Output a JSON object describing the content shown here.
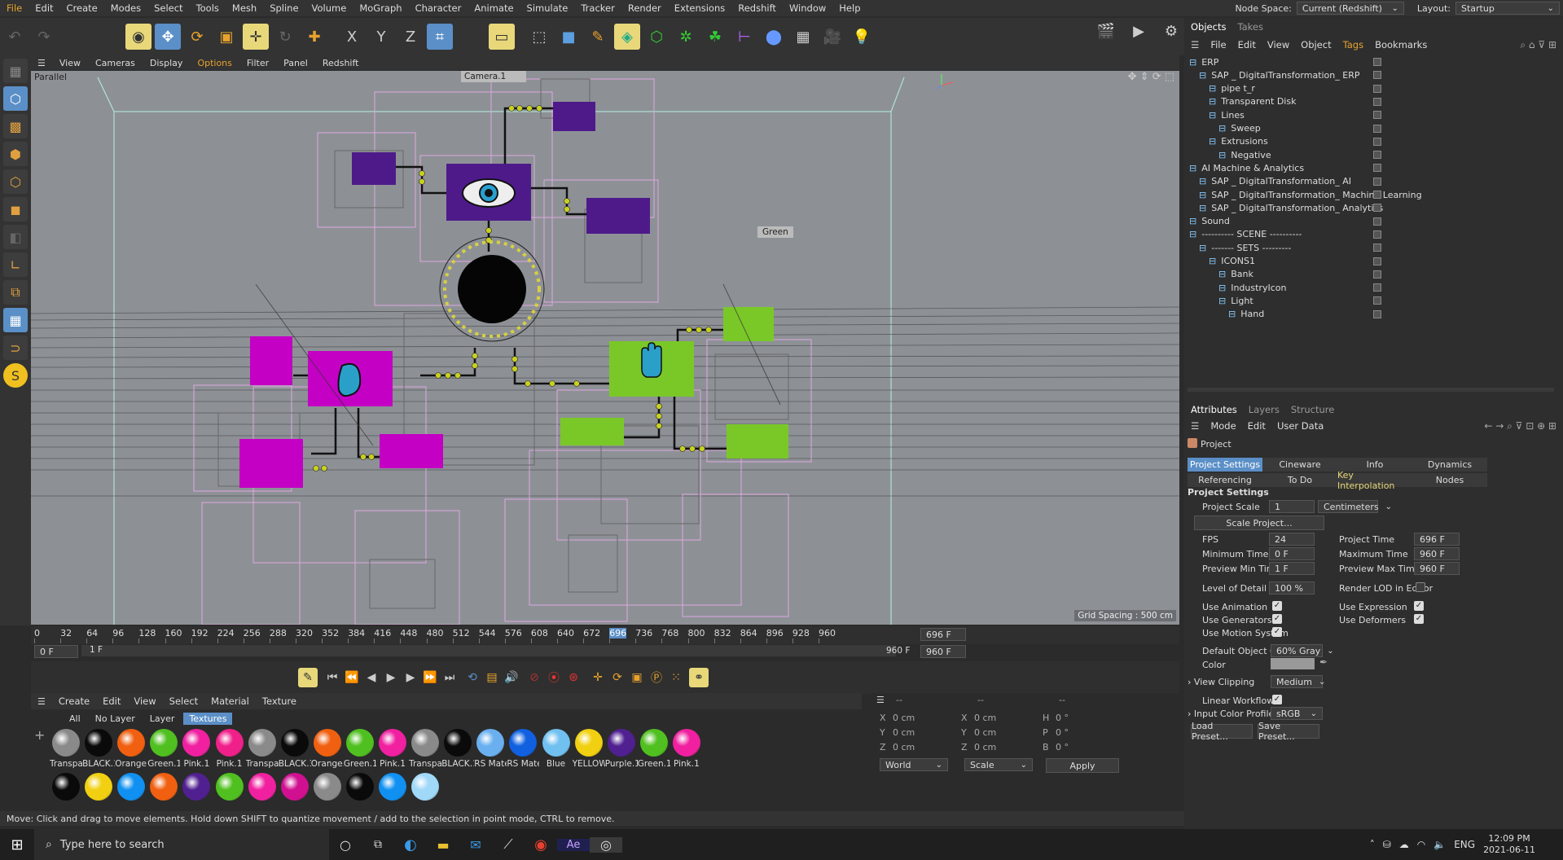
{
  "menubar": {
    "items": [
      "File",
      "Edit",
      "Create",
      "Modes",
      "Select",
      "Tools",
      "Mesh",
      "Spline",
      "Volume",
      "MoGraph",
      "Character",
      "Animate",
      "Simulate",
      "Tracker",
      "Render",
      "Extensions",
      "Redshift",
      "Window",
      "Help"
    ],
    "node_space_label": "Node Space:",
    "node_space_value": "Current (Redshift)",
    "layout_label": "Layout:",
    "layout_value": "Startup"
  },
  "viewport": {
    "menu": [
      "View",
      "Cameras",
      "Display",
      "Options",
      "Filter",
      "Panel",
      "Redshift"
    ],
    "active_menu": "Options",
    "projection": "Parallel",
    "camera": "Camera.1",
    "tag_label": "Green",
    "grid_spacing": "Grid Spacing : 500 cm",
    "colors": {
      "bg": "#8d9196",
      "purple": "#4e1a8a",
      "magenta": "#c400c4",
      "green": "#7ac828"
    }
  },
  "timeline": {
    "ticks": [
      "0",
      "32",
      "64",
      "96",
      "128",
      "160",
      "192",
      "224",
      "256",
      "288",
      "320",
      "352",
      "384",
      "416",
      "448",
      "480",
      "512",
      "544",
      "576",
      "608",
      "640",
      "672",
      "696",
      "736",
      "768",
      "800",
      "832",
      "864",
      "896",
      "928",
      "960"
    ],
    "current_frame": "696 F",
    "end_frame": "960 F",
    "range_start": "0 F",
    "range_label": "1 F",
    "range_end": "960 F",
    "range_end2": "960 F"
  },
  "materials": {
    "menu": [
      "Create",
      "Edit",
      "View",
      "Select",
      "Material",
      "Texture"
    ],
    "filters": [
      "All",
      "No Layer",
      "Layer",
      "Textures"
    ],
    "active_filter": "Textures",
    "row1": [
      {
        "name": "Transpar",
        "color": "#8a8a8a"
      },
      {
        "name": "BLACK.1",
        "color": "#0a0a0a"
      },
      {
        "name": "Orange.",
        "color": "#f06010"
      },
      {
        "name": "Green.1",
        "color": "#50c020"
      },
      {
        "name": "Pink.1",
        "color": "#f020a0"
      },
      {
        "name": "Pink.1",
        "color": "#f0208a"
      },
      {
        "name": "Transpar",
        "color": "#8a8a8a"
      },
      {
        "name": "BLACK.1",
        "color": "#0a0a0a"
      },
      {
        "name": "Orange.",
        "color": "#f06010"
      },
      {
        "name": "Green.1",
        "color": "#50c020"
      },
      {
        "name": "Pink.1",
        "color": "#f020a0"
      },
      {
        "name": "Transpar",
        "color": "#8a8a8a"
      },
      {
        "name": "BLACK.1",
        "color": "#0a0a0a"
      },
      {
        "name": "RS Mate",
        "color": "#6ab0f0"
      },
      {
        "name": "RS Mate",
        "color": "#1060e0"
      },
      {
        "name": "Blue",
        "color": "#70c0f0"
      },
      {
        "name": "YELLOW",
        "color": "#f0d010"
      },
      {
        "name": "Purple.1",
        "color": "#502090"
      },
      {
        "name": "Green.1",
        "color": "#50c020"
      },
      {
        "name": "Pink.1",
        "color": "#f020a0"
      }
    ],
    "row2_colors": [
      "#0a0a0a",
      "#f0d010",
      "#1090f0",
      "#f06010",
      "#502090",
      "#50c020",
      "#f020a0",
      "#d01090",
      "#8a8a8a",
      "#0a0a0a",
      "#1090f0",
      "#a0d8f8"
    ]
  },
  "coords": {
    "headers": [
      "--",
      "--",
      "--"
    ],
    "rows": [
      {
        "a": "X",
        "av": "0 cm",
        "b": "X",
        "bv": "0 cm",
        "c": "H",
        "cv": "0 °"
      },
      {
        "a": "Y",
        "av": "0 cm",
        "b": "Y",
        "bv": "0 cm",
        "c": "P",
        "cv": "0 °"
      },
      {
        "a": "Z",
        "av": "0 cm",
        "b": "Z",
        "bv": "0 cm",
        "c": "B",
        "cv": "0 °"
      }
    ],
    "mode1": "World",
    "mode2": "Scale",
    "apply": "Apply"
  },
  "statusbar": {
    "text": "Move: Click and drag to move elements. Hold down SHIFT to quantize movement / add to the selection in point mode, CTRL to remove."
  },
  "taskbar": {
    "search_placeholder": "Type here to search",
    "lang": "ENG",
    "time": "12:09 PM",
    "date": "2021-06-11"
  },
  "objects": {
    "tabs": [
      "Objects",
      "Takes"
    ],
    "menu": [
      "File",
      "Edit",
      "View",
      "Object",
      "Tags",
      "Bookmarks"
    ],
    "active_menu": "Tags",
    "rows": [
      {
        "name": "ERP",
        "indent": 0
      },
      {
        "name": "SAP _ DigitalTransformation_ ERP",
        "indent": 1
      },
      {
        "name": "pipe t_r",
        "indent": 2
      },
      {
        "name": "Transparent Disk",
        "indent": 2
      },
      {
        "name": "Lines",
        "indent": 2
      },
      {
        "name": "Sweep",
        "indent": 3
      },
      {
        "name": "Extrusions",
        "indent": 2
      },
      {
        "name": "Negative",
        "indent": 3
      },
      {
        "name": "AI Machine & Analytics",
        "indent": 0
      },
      {
        "name": "SAP _ DigitalTransformation_ AI",
        "indent": 1
      },
      {
        "name": "SAP _ DigitalTransformation_ Machine Learning",
        "indent": 1
      },
      {
        "name": "SAP _ DigitalTransformation_ Analytics",
        "indent": 1
      },
      {
        "name": "Sound",
        "indent": 0
      },
      {
        "name": "---------- SCENE ----------",
        "indent": 0
      },
      {
        "name": "-------  SETS  ---------",
        "indent": 1
      },
      {
        "name": "ICONS1",
        "indent": 2
      },
      {
        "name": "Bank",
        "indent": 3
      },
      {
        "name": "IndustryIcon",
        "indent": 3
      },
      {
        "name": "Light",
        "indent": 3
      },
      {
        "name": "Hand",
        "indent": 4
      }
    ]
  },
  "attributes": {
    "tabs": [
      "Attributes",
      "Layers",
      "Structure"
    ],
    "menu": [
      "Mode",
      "Edit",
      "User Data"
    ],
    "object": "Project",
    "ptabs": [
      "Project Settings",
      "Cineware",
      "Info",
      "Dynamics",
      "Referencing",
      "To Do",
      "Key Interpolation",
      "Nodes"
    ],
    "section": "Project Settings",
    "project_scale_label": "Project Scale",
    "project_scale": "1",
    "units": "Centimeters",
    "scale_button": "Scale Project...",
    "fps_label": "FPS",
    "fps": "24",
    "project_time_label": "Project Time",
    "project_time": "696 F",
    "min_time_label": "Minimum Time",
    "min_time": "0 F",
    "max_time_label": "Maximum Time",
    "max_time": "960 F",
    "prev_min_label": "Preview Min Time",
    "prev_min": "1 F",
    "prev_max_label": "Preview Max Time",
    "prev_max": "960 F",
    "lod_label": "Level of Detail",
    "lod": "100 %",
    "render_lod_label": "Render LOD in Editor",
    "use_animation": "Use Animation",
    "use_expression": "Use Expression",
    "use_generators": "Use Generators",
    "use_deformers": "Use Deformers",
    "use_motion": "Use Motion System",
    "default_color_label": "Default Object Color",
    "default_color": "60% Gray",
    "color_label": "Color",
    "view_clipping_label": "View Clipping",
    "view_clipping": "Medium",
    "linear_workflow": "Linear Workflow",
    "input_profile_label": "Input Color Profile",
    "input_profile": "sRGB",
    "load_preset": "Load Preset...",
    "save_preset": "Save Preset..."
  }
}
